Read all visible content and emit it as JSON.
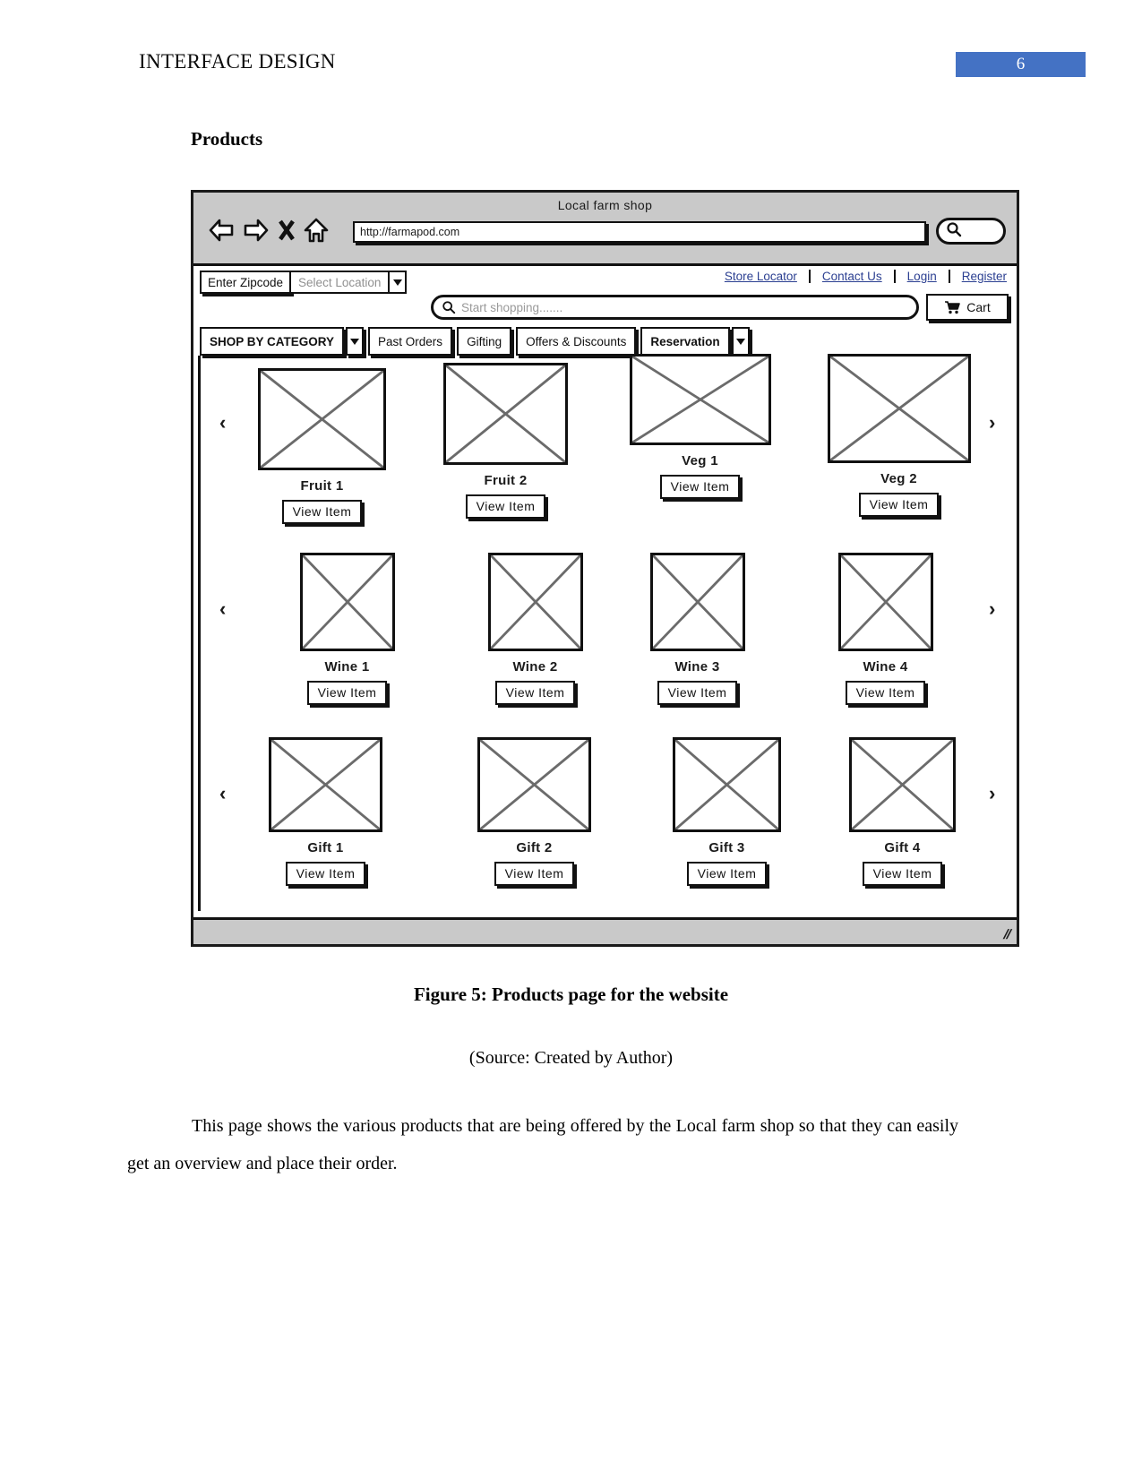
{
  "document": {
    "running_head": "INTERFACE DESIGN",
    "page_number": "6",
    "section_heading": "Products",
    "figure_caption": "Figure 5: Products page for the website",
    "figure_source": "(Source: Created by Author)",
    "body_paragraph": "This page shows the various products that are being offered by the Local farm shop so that they can easily get an overview and place their order.",
    "accent_color": "#4472C4",
    "link_color": "#2b3f91"
  },
  "wireframe": {
    "browser": {
      "title": "Local farm shop",
      "url": "http://farmapod.com",
      "back_icon": "back-arrow-icon",
      "forward_icon": "forward-arrow-icon",
      "stop_icon": "close-x-icon",
      "home_icon": "home-icon",
      "search_icon": "search-icon"
    },
    "header": {
      "zipcode_placeholder": "Enter Zipcode",
      "location_placeholder": "Select Location",
      "location_caret_icon": "chevron-down-icon",
      "links": [
        {
          "label": "Store Locator"
        },
        {
          "label": "Contact Us"
        },
        {
          "label": "Login"
        },
        {
          "label": "Register"
        }
      ],
      "search_placeholder": "Start shopping.......",
      "search_icon": "search-icon",
      "cart_label": "Cart",
      "cart_icon": "shopping-cart-icon"
    },
    "nav": {
      "items": [
        {
          "label": "SHOP BY CATEGORY",
          "caret": true,
          "bold": true
        },
        {
          "label": "Past Orders",
          "caret": false,
          "bold": false
        },
        {
          "label": "Gifting",
          "caret": false,
          "bold": false
        },
        {
          "label": "Offers & Discounts",
          "caret": false,
          "bold": false
        },
        {
          "label": "Reservation",
          "caret": true,
          "bold": true
        }
      ]
    },
    "carousels": [
      {
        "prev_icon": "chevron-left-icon",
        "next_icon": "chevron-right-icon",
        "items": [
          {
            "label": "Fruit 1",
            "button": "View Item"
          },
          {
            "label": "Fruit 2",
            "button": "View Item"
          },
          {
            "label": "Veg 1",
            "button": "View Item"
          },
          {
            "label": "Veg 2",
            "button": "View Item"
          }
        ]
      },
      {
        "prev_icon": "chevron-left-icon",
        "next_icon": "chevron-right-icon",
        "items": [
          {
            "label": "Wine 1",
            "button": "View Item"
          },
          {
            "label": "Wine 2",
            "button": "View Item"
          },
          {
            "label": "Wine 3",
            "button": "View Item"
          },
          {
            "label": "Wine 4",
            "button": "View Item"
          }
        ]
      },
      {
        "prev_icon": "chevron-left-icon",
        "next_icon": "chevron-right-icon",
        "items": [
          {
            "label": "Gift 1",
            "button": "View Item"
          },
          {
            "label": "Gift 2",
            "button": "View Item"
          },
          {
            "label": "Gift 3",
            "button": "View Item"
          },
          {
            "label": "Gift 4",
            "button": "View Item"
          }
        ]
      }
    ],
    "footer": {
      "resize_grip_icon": "resize-grip-icon",
      "resize_grip_glyph": "//"
    }
  }
}
